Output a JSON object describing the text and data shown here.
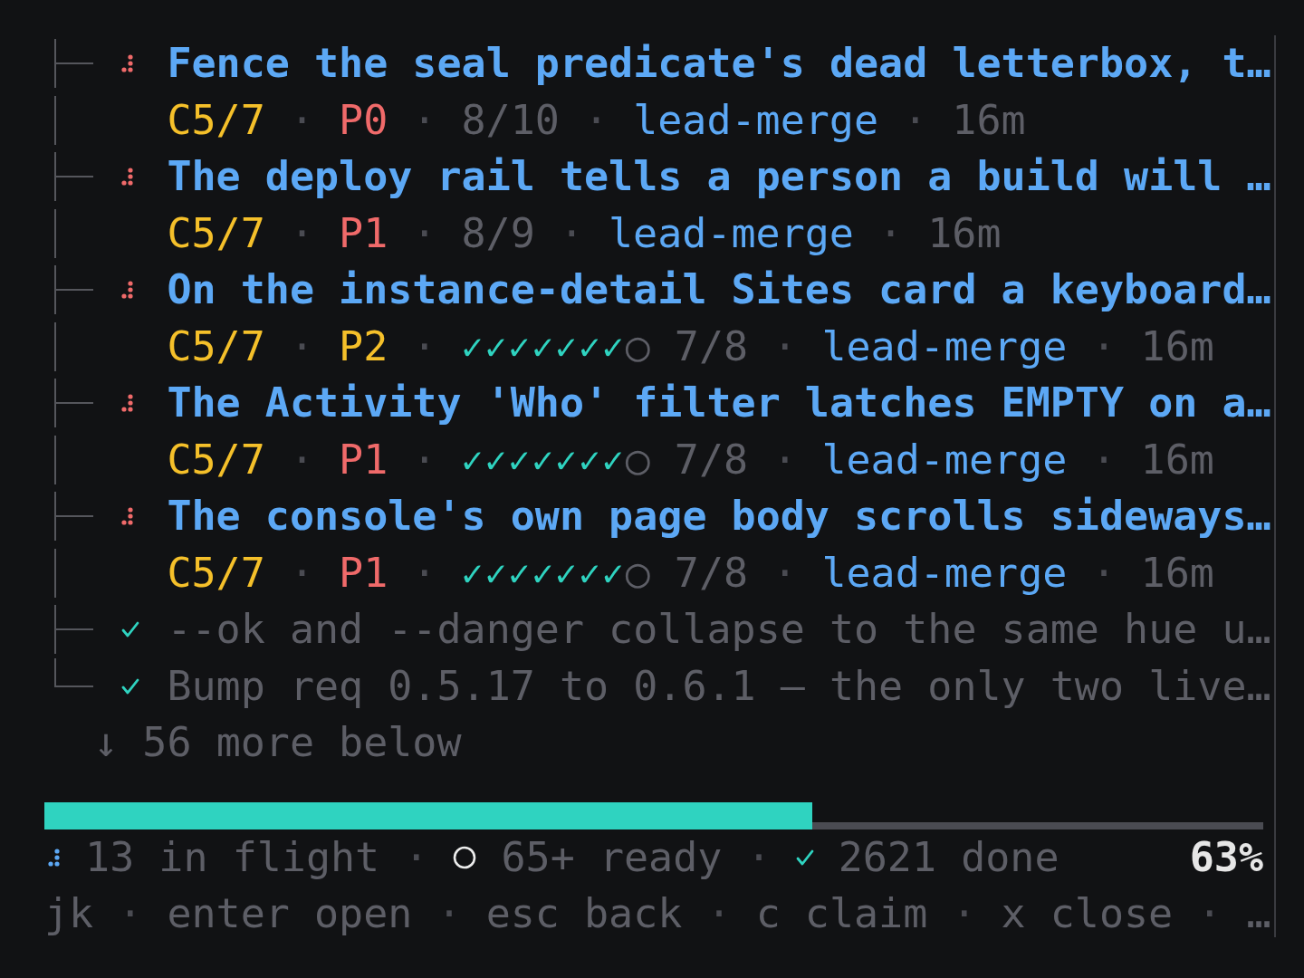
{
  "separator": "·",
  "tree": {
    "items": [
      {
        "kind": "active",
        "title": "Fence the seal predicate's dead letterbox, t…",
        "meta": {
          "cycle": "C5/7",
          "priority": "P0",
          "color": "#f06a6a",
          "progress": "8/10",
          "owner": "lead-merge",
          "age": "16m"
        }
      },
      {
        "kind": "active",
        "title": "The deploy rail tells a person a build will …",
        "meta": {
          "cycle": "C5/7",
          "priority": "P1",
          "color": "#f06a6a",
          "progress": "8/9",
          "owner": "lead-merge",
          "age": "16m"
        }
      },
      {
        "kind": "active",
        "title": "On the instance-detail Sites card a keyboard…",
        "meta": {
          "cycle": "C5/7",
          "priority": "P2",
          "color": "#f5c02a",
          "checklist": {
            "done": "✓✓✓✓✓✓✓",
            "open": "○"
          },
          "progress": "7/8",
          "owner": "lead-merge",
          "age": "16m"
        }
      },
      {
        "kind": "active",
        "title": "The Activity 'Who' filter latches EMPTY on a…",
        "meta": {
          "cycle": "C5/7",
          "priority": "P1",
          "color": "#f06a6a",
          "checklist": {
            "done": "✓✓✓✓✓✓✓",
            "open": "○"
          },
          "progress": "7/8",
          "owner": "lead-merge",
          "age": "16m"
        }
      },
      {
        "kind": "active",
        "title": "The console's own page body scrolls sideways…",
        "meta": {
          "cycle": "C5/7",
          "priority": "P1",
          "color": "#f06a6a",
          "checklist": {
            "done": "✓✓✓✓✓✓✓",
            "open": "○"
          },
          "progress": "7/8",
          "owner": "lead-merge",
          "age": "16m"
        }
      },
      {
        "kind": "done",
        "title": "--ok and --danger collapse to the same hue u…"
      },
      {
        "kind": "done",
        "title": "Bump req 0.5.17 to 0.6.1 — the only two live…"
      }
    ],
    "more": "↓ 56 more below"
  },
  "status_bar": {
    "level": 0.63,
    "in_flight": "13 in flight",
    "ready": "65+ ready",
    "done": "2621 done",
    "percent": "63%"
  },
  "keys": [
    "jk",
    "enter open",
    "esc back",
    "c claim",
    "x close",
    "…"
  ]
}
